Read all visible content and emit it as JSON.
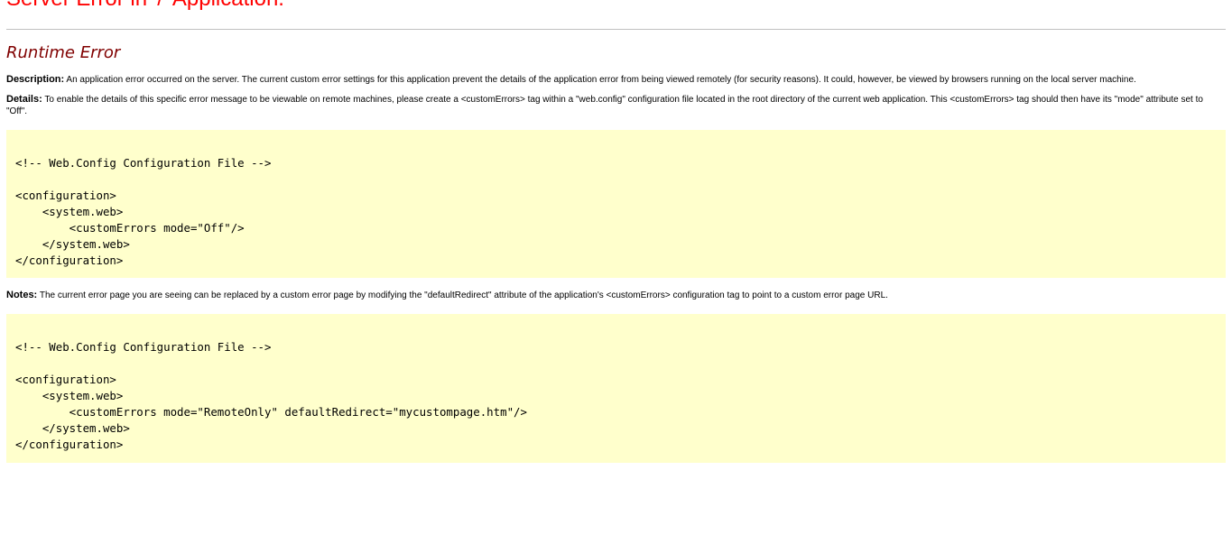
{
  "header": {
    "title": "Server Error in '/' Application."
  },
  "main": {
    "subtitle": "Runtime Error",
    "description": {
      "label": "Description:",
      "text": " An application error occurred on the server. The current custom error settings for this application prevent the details of the application error from being viewed remotely (for security reasons). It could, however, be viewed by browsers running on the local server machine."
    },
    "details": {
      "label": "Details:",
      "text": " To enable the details of this specific error message to be viewable on remote machines, please create a <customErrors> tag within a \"web.config\" configuration file located in the root directory of the current web application. This <customErrors> tag should then have its \"mode\" attribute set to \"Off\"."
    },
    "code1": "<!-- Web.Config Configuration File -->\n\n<configuration>\n    <system.web>\n        <customErrors mode=\"Off\"/>\n    </system.web>\n</configuration>",
    "notes": {
      "label": "Notes:",
      "text": " The current error page you are seeing can be replaced by a custom error page by modifying the \"defaultRedirect\" attribute of the application's <customErrors> configuration tag to point to a custom error page URL."
    },
    "code2": "<!-- Web.Config Configuration File -->\n\n<configuration>\n    <system.web>\n        <customErrors mode=\"RemoteOnly\" defaultRedirect=\"mycustompage.htm\"/>\n    </system.web>\n</configuration>"
  },
  "colors": {
    "title": "#ff0000",
    "subtitle": "#800000",
    "code_background": "#ffffcc",
    "rule": "#c0c0c0"
  }
}
